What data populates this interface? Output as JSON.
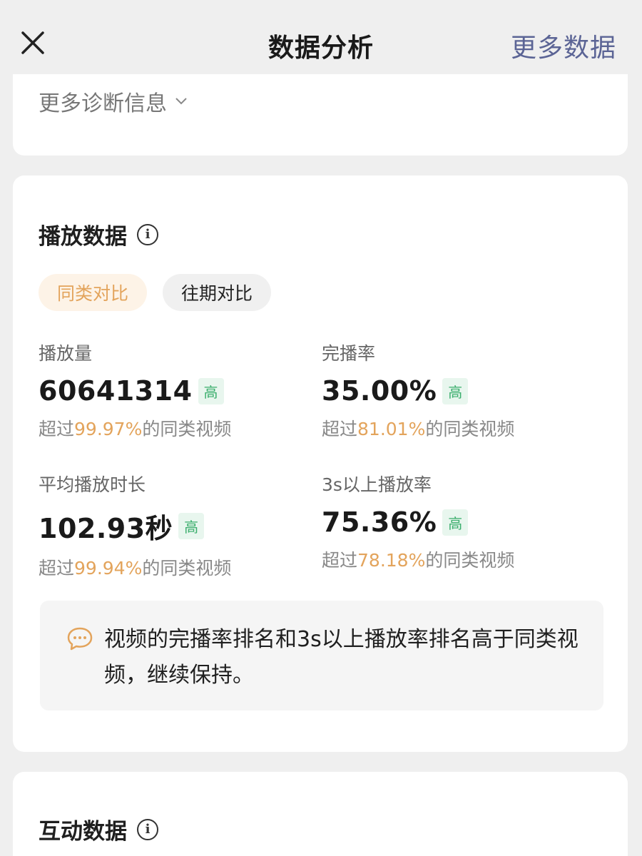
{
  "header": {
    "title": "数据分析",
    "more_label": "更多数据"
  },
  "diagnosis": {
    "more_label": "更多诊断信息"
  },
  "play": {
    "title": "播放数据",
    "tabs": [
      {
        "label": "同类对比",
        "active": true
      },
      {
        "label": "往期对比",
        "active": false
      }
    ],
    "metrics": [
      {
        "label": "播放量",
        "value": "60641314",
        "badge": "高",
        "prefix": "超过",
        "pct": "99.97%",
        "suffix": "的同类视频",
        "pct_value": 99.97
      },
      {
        "label": "完播率",
        "value": "35.00%",
        "badge": "高",
        "prefix": "超过",
        "pct": "81.01%",
        "suffix": "的同类视频",
        "pct_value": 81.01
      },
      {
        "label": "平均播放时长",
        "value": "102.93秒",
        "badge": "高",
        "prefix": "超过",
        "pct": "99.94%",
        "suffix": "的同类视频",
        "pct_value": 99.94
      },
      {
        "label": "3s以上播放率",
        "value": "75.36%",
        "badge": "高",
        "prefix": "超过",
        "pct": "78.18%",
        "suffix": "的同类视频",
        "pct_value": 78.18
      }
    ],
    "tip": "视频的完播率排名和3s以上播放率排名高于同类视频，继续保持。"
  },
  "interact": {
    "title": "互动数据"
  },
  "colors": {
    "accent": "#e3a45c",
    "link": "#5b6495",
    "badge_text": "#3aae6c",
    "badge_bg": "#e8f6ee"
  },
  "icons": {
    "close": "close-icon",
    "info": "info-icon",
    "chevron": "chevron-down-icon",
    "tip": "chat-bubble-icon"
  }
}
